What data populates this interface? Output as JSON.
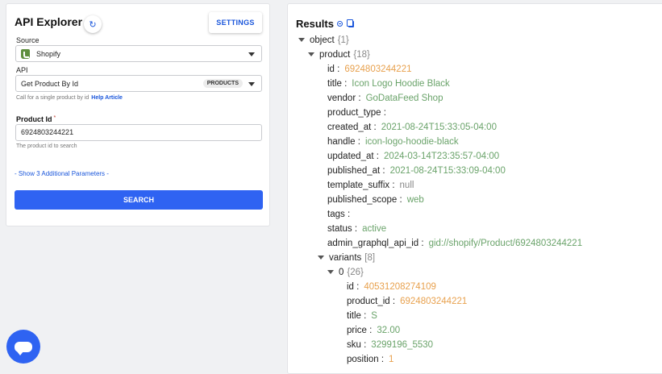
{
  "left": {
    "title": "API Explorer",
    "settings_label": "SETTINGS",
    "source_label": "Source",
    "source_value": "Shopify",
    "api_label": "API",
    "api_value": "Get Product By Id",
    "api_badge": "PRODUCTS",
    "api_helper": "Call for a single product by id",
    "help_link": "Help Article",
    "pid_label": "Product Id",
    "pid_required": "*",
    "pid_value": "6924803244221",
    "pid_helper": "The product id to search",
    "show_more": "- Show 3 Additional Parameters -",
    "search_label": "SEARCH"
  },
  "results": {
    "title": "Results",
    "rows": [
      {
        "indent": 0,
        "toggle": true,
        "key": "object",
        "meta": "{1}"
      },
      {
        "indent": 1,
        "toggle": true,
        "key": "product",
        "meta": "{18}"
      },
      {
        "indent": 2,
        "key": "id",
        "value": "6924803244221",
        "type": "num"
      },
      {
        "indent": 2,
        "key": "title",
        "value": "Icon Logo Hoodie Black",
        "type": "str"
      },
      {
        "indent": 2,
        "key": "vendor",
        "value": "GoDataFeed Shop",
        "type": "str"
      },
      {
        "indent": 2,
        "key": "product_type",
        "value": "",
        "type": "str"
      },
      {
        "indent": 2,
        "key": "created_at",
        "value": "2021-08-24T15:33:05-04:00",
        "type": "str"
      },
      {
        "indent": 2,
        "key": "handle",
        "value": "icon-logo-hoodie-black",
        "type": "str"
      },
      {
        "indent": 2,
        "key": "updated_at",
        "value": "2024-03-14T23:35:57-04:00",
        "type": "str"
      },
      {
        "indent": 2,
        "key": "published_at",
        "value": "2021-08-24T15:33:09-04:00",
        "type": "str"
      },
      {
        "indent": 2,
        "key": "template_suffix",
        "value": "null",
        "type": "nul"
      },
      {
        "indent": 2,
        "key": "published_scope",
        "value": "web",
        "type": "str"
      },
      {
        "indent": 2,
        "key": "tags",
        "value": "",
        "type": "str"
      },
      {
        "indent": 2,
        "key": "status",
        "value": "active",
        "type": "str"
      },
      {
        "indent": 2,
        "key": "admin_graphql_api_id",
        "value": "gid://shopify/Product/6924803244221",
        "type": "str"
      },
      {
        "indent": 2,
        "toggle": true,
        "key": "variants",
        "meta": "[8]"
      },
      {
        "indent": 3,
        "toggle": true,
        "key": "0",
        "meta": "{26}"
      },
      {
        "indent": 4,
        "key": "id",
        "value": "40531208274109",
        "type": "num"
      },
      {
        "indent": 4,
        "key": "product_id",
        "value": "6924803244221",
        "type": "num"
      },
      {
        "indent": 4,
        "key": "title",
        "value": "S",
        "type": "str"
      },
      {
        "indent": 4,
        "key": "price",
        "value": "32.00",
        "type": "str"
      },
      {
        "indent": 4,
        "key": "sku",
        "value": "3299196_5530",
        "type": "str"
      },
      {
        "indent": 4,
        "key": "position",
        "value": "1",
        "type": "num"
      }
    ]
  }
}
